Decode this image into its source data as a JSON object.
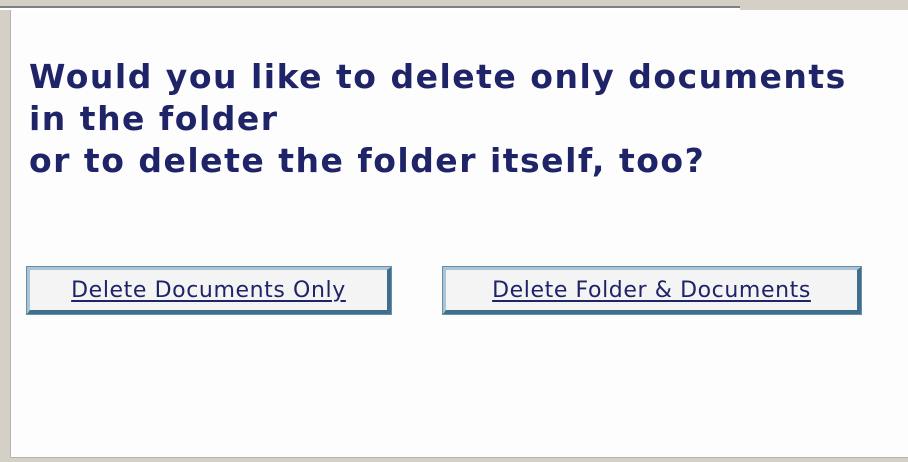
{
  "dialog": {
    "question_lines": [
      "Would you like to delete only documents",
      "in the folder",
      "or to delete the folder itself, too?"
    ],
    "buttons": {
      "delete_documents_only": "Delete Documents Only",
      "delete_folder_and_documents": "Delete Folder & Documents"
    }
  },
  "colors": {
    "text": "#1f2468",
    "button_border_dark": "#3f6f8c",
    "button_border_light": "#a9c6d6",
    "background": "#fdfdfd",
    "chrome": "#d4d0c8"
  }
}
